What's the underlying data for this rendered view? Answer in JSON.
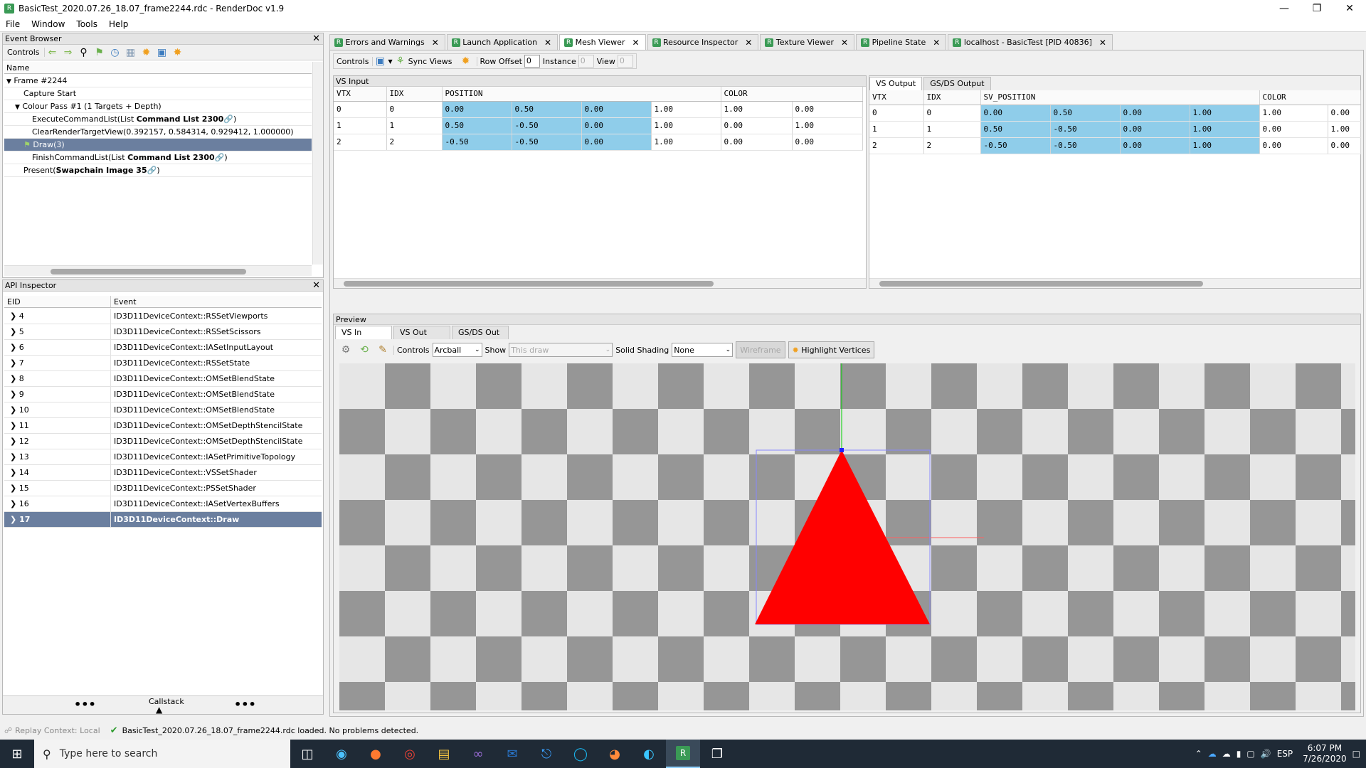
{
  "window": {
    "title": "BasicTest_2020.07.26_18.07_frame2244.rdc - RenderDoc v1.9"
  },
  "menu": [
    "File",
    "Window",
    "Tools",
    "Help"
  ],
  "event_browser": {
    "title": "Event Browser",
    "controls_label": "Controls",
    "column_name": "Name",
    "rows": [
      {
        "text": "Frame #2244",
        "prefix": "",
        "bold": "",
        "suffix": ""
      },
      {
        "text": "Capture Start",
        "prefix": "",
        "bold": "",
        "suffix": ""
      },
      {
        "text": "Colour Pass #1 (1 Targets + Depth)",
        "prefix": "",
        "bold": "",
        "suffix": ""
      },
      {
        "text": "",
        "prefix": "ExecuteCommandList(List ",
        "bold": "Command List 2300",
        "suffix": ")"
      },
      {
        "text": "ClearRenderTargetView(0.392157, 0.584314, 0.929412, 1.000000)",
        "prefix": "",
        "bold": "",
        "suffix": ""
      },
      {
        "text": "Draw(3)",
        "prefix": "",
        "bold": "",
        "suffix": ""
      },
      {
        "text": "",
        "prefix": "FinishCommandList(List ",
        "bold": "Command List 2300",
        "suffix": ")"
      },
      {
        "text": "",
        "prefix": "Present(",
        "bold": "Swapchain Image 35",
        "suffix": ")"
      }
    ]
  },
  "api_inspector": {
    "title": "API Inspector",
    "col_eid": "EID",
    "col_event": "Event",
    "rows": [
      {
        "eid": "4",
        "event": "ID3D11DeviceContext::RSSetViewports"
      },
      {
        "eid": "5",
        "event": "ID3D11DeviceContext::RSSetScissors"
      },
      {
        "eid": "6",
        "event": "ID3D11DeviceContext::IASetInputLayout"
      },
      {
        "eid": "7",
        "event": "ID3D11DeviceContext::RSSetState"
      },
      {
        "eid": "8",
        "event": "ID3D11DeviceContext::OMSetBlendState"
      },
      {
        "eid": "9",
        "event": "ID3D11DeviceContext::OMSetBlendState"
      },
      {
        "eid": "10",
        "event": "ID3D11DeviceContext::OMSetBlendState"
      },
      {
        "eid": "11",
        "event": "ID3D11DeviceContext::OMSetDepthStencilState"
      },
      {
        "eid": "12",
        "event": "ID3D11DeviceContext::OMSetDepthStencilState"
      },
      {
        "eid": "13",
        "event": "ID3D11DeviceContext::IASetPrimitiveTopology"
      },
      {
        "eid": "14",
        "event": "ID3D11DeviceContext::VSSetShader"
      },
      {
        "eid": "15",
        "event": "ID3D11DeviceContext::PSSetShader"
      },
      {
        "eid": "16",
        "event": "ID3D11DeviceContext::IASetVertexBuffers"
      },
      {
        "eid": "17",
        "event": "ID3D11DeviceContext::Draw"
      }
    ],
    "callstack_label": "Callstack"
  },
  "tabs": [
    "Errors and Warnings",
    "Launch Application",
    "Mesh Viewer",
    "Resource Inspector",
    "Texture Viewer",
    "Pipeline State",
    "localhost - BasicTest [PID 40836]"
  ],
  "mesh_toolbar": {
    "controls": "Controls",
    "sync_views": "Sync Views",
    "row_offset_label": "Row Offset",
    "row_offset": "0",
    "instance_label": "Instance",
    "instance": "0",
    "view_label": "View",
    "view": "0"
  },
  "vs_input": {
    "title": "VS Input",
    "headers": [
      "VTX",
      "IDX",
      "POSITION",
      "COLOR"
    ],
    "rows": [
      [
        "0",
        "0",
        "0.00",
        "0.50",
        "0.00",
        "1.00",
        "1.00",
        "0.00"
      ],
      [
        "1",
        "1",
        "0.50",
        "-0.50",
        "0.00",
        "1.00",
        "0.00",
        "1.00"
      ],
      [
        "2",
        "2",
        "-0.50",
        "-0.50",
        "0.00",
        "1.00",
        "0.00",
        "0.00"
      ]
    ]
  },
  "vs_output": {
    "tabs": [
      "VS Output",
      "GS/DS Output"
    ],
    "headers": [
      "VTX",
      "IDX",
      "SV_POSITION",
      "COLOR"
    ],
    "rows": [
      [
        "0",
        "0",
        "0.00",
        "0.50",
        "0.00",
        "1.00",
        "1.00",
        "0.00"
      ],
      [
        "1",
        "1",
        "0.50",
        "-0.50",
        "0.00",
        "1.00",
        "0.00",
        "1.00"
      ],
      [
        "2",
        "2",
        "-0.50",
        "-0.50",
        "0.00",
        "1.00",
        "0.00",
        "0.00"
      ]
    ]
  },
  "preview": {
    "title": "Preview",
    "tabs": [
      "VS In",
      "VS Out",
      "GS/DS Out"
    ],
    "controls_label": "Controls",
    "controls_value": "Arcball",
    "show_label": "Show",
    "show_value": "This draw",
    "shading_label": "Solid Shading",
    "shading_value": "None",
    "wireframe": "Wireframe",
    "highlight": "Highlight Vertices",
    "triangle_color": "#ff0000"
  },
  "statusbar": {
    "replay": "Replay Context: Local",
    "message": "BasicTest_2020.07.26_18.07_frame2244.rdc loaded. No problems detected."
  },
  "taskbar": {
    "search_placeholder": "Type here to search",
    "lang": "ESP",
    "time": "6:07 PM",
    "date": "7/26/2020"
  }
}
